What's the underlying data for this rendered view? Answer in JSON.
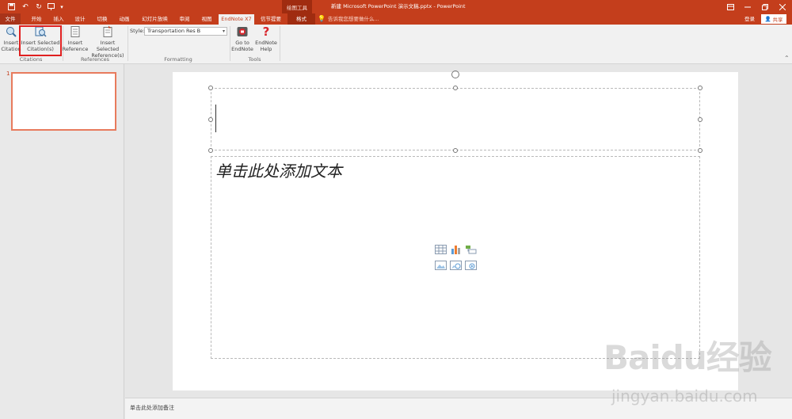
{
  "titlebar": {
    "context_group": "绘图工具",
    "title": "新建 Microsoft PowerPoint 演示文稿.pptx - PowerPoint"
  },
  "qat": {
    "more": "▾"
  },
  "tabs": [
    {
      "label": "文件"
    },
    {
      "label": "开始"
    },
    {
      "label": "插入"
    },
    {
      "label": "设计"
    },
    {
      "label": "切换"
    },
    {
      "label": "动画"
    },
    {
      "label": "幻灯片放映"
    },
    {
      "label": "审阅"
    },
    {
      "label": "视图"
    },
    {
      "label": "EndNote X7"
    },
    {
      "label": "信节提要"
    },
    {
      "label": "格式"
    }
  ],
  "tellme": "告诉我您想要做什么...",
  "account": {
    "signin": "登录",
    "share": "共享"
  },
  "ribbon": {
    "insert_citation": "Insert\nCitation",
    "insert_selected_citation": "Insert Selected\nCitation(s)",
    "insert_reference": "Insert\nReference",
    "insert_selected_reference": "Insert Selected\nReference(s)",
    "style_label": "Style:",
    "style_value": "Transportation Res B",
    "go_to_endnote": "Go to\nEndNote",
    "endnote_help": "EndNote\nHelp",
    "groups": {
      "citations": "Citations",
      "references": "References",
      "formatting": "Formatting",
      "tools": "Tools"
    }
  },
  "slides": {
    "thumb_number": "1"
  },
  "slide": {
    "content_placeholder": "单击此处添加文本"
  },
  "notes": {
    "placeholder": "单击此处添加备注"
  },
  "watermark": {
    "logo": "Baidu经验",
    "url": "jingyan.baidu.com"
  },
  "colors": {
    "accent": "#c43e1c",
    "highlight": "#e02020"
  }
}
